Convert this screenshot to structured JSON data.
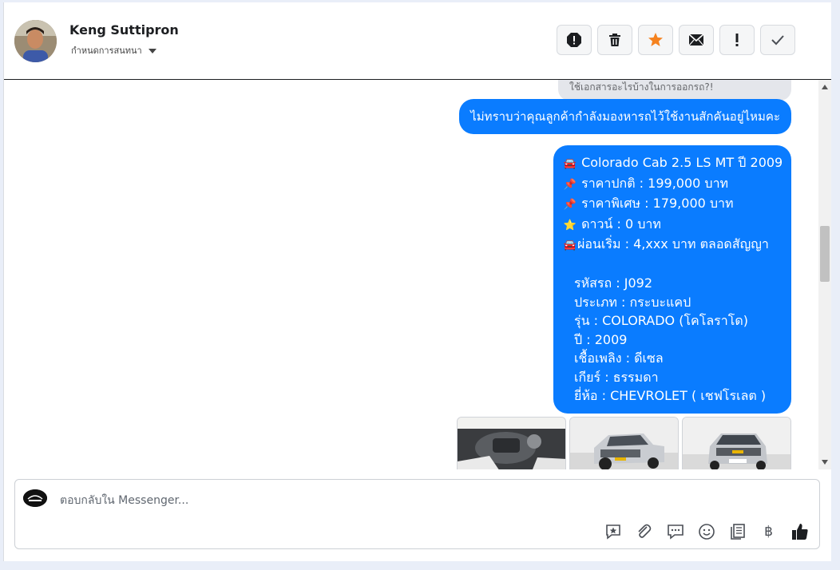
{
  "header": {
    "contact_name": "Keng Suttipron",
    "assign_label": "กำหนดการสนทนา"
  },
  "toolbar": {
    "buttons": [
      {
        "name": "spam-icon"
      },
      {
        "name": "trash-icon"
      },
      {
        "name": "star-icon",
        "color": "#f5821f"
      },
      {
        "name": "envelope-icon"
      },
      {
        "name": "exclamation-icon"
      },
      {
        "name": "check-icon"
      }
    ]
  },
  "messages": {
    "prev_text": "ใช้เอกสารอะไรบ้างในการออกรถ?!",
    "question": "ไม่ทราบว่าคุณลูกค้ากำลังมองหารถไว้ใช้งานสักคันอยู่ไหมคะ",
    "car_lines": [
      {
        "emoji": "🚘",
        "text": "Colorado Cab 2.5 LS MT ปี 2009"
      },
      {
        "emoji": "📌",
        "text": "ราคาปกติ : 199,000 บาท"
      },
      {
        "emoji": "📌",
        "text": "ราคาพิเศษ : 179,000 บาท"
      },
      {
        "emoji": "⭐",
        "text": "ดาวน์ : 0 บาท"
      },
      {
        "emoji": "🚘",
        "text": "ผ่อนเริ่ม : 4,xxx บาท ตลอดสัญญา"
      }
    ],
    "detail_lines": [
      "รหัสรถ : J092",
      "ประเภท : กระบะแคป",
      "รุ่น : COLORADO (โคโลราโด)",
      "ปี : 2009",
      "เชื้อเพลิง : ดีเซล",
      "เกียร์ : ธรรมดา",
      "ยี่ห้อ : CHEVROLET ( เชฟโรเลต )"
    ]
  },
  "composer": {
    "placeholder": "ตอบกลับใน Messenger...",
    "tools": [
      "saved-reply-icon",
      "paperclip-icon",
      "chat-bubble-icon",
      "smiley-icon",
      "document-icon",
      "baht-icon",
      "thumbs-up-icon"
    ],
    "baht_symbol": "฿"
  },
  "colors": {
    "bubble": "#0a7cff",
    "accent_star": "#f5821f"
  }
}
